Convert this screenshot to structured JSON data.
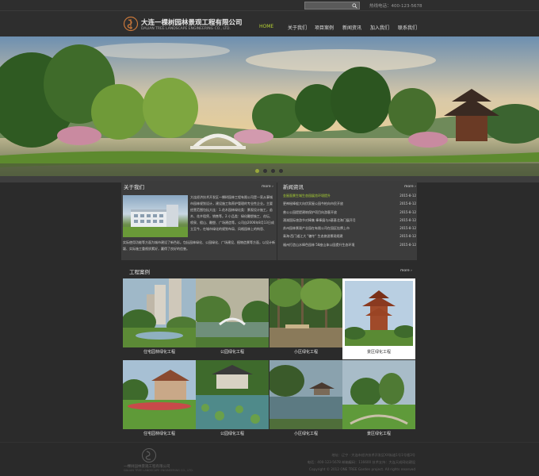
{
  "topbar": {
    "search_placeholder": "",
    "hotline": "热线电话：400-123-5678"
  },
  "brand": {
    "name_cn": "大连一棵树园林景观工程有限公司",
    "name_en": "DALIAN TREE LANDSCAPE ENGINEERING CO., LTD."
  },
  "nav": {
    "items": [
      {
        "label": "HOME",
        "active": true
      },
      {
        "label": "关于我们",
        "active": false
      },
      {
        "label": "项目案例",
        "active": false
      },
      {
        "label": "新闻资讯",
        "active": false
      },
      {
        "label": "加入我们",
        "active": false
      },
      {
        "label": "联系我们",
        "active": false
      }
    ]
  },
  "banner": {
    "slides": 4,
    "active_slide": 1
  },
  "about": {
    "title": "关于我们",
    "more": "more ›",
    "text_a": "大连经济技术开发区一棵树园林工程有限公司是一家从事城市园林规划设计，建设施工和养护管理的专业性企业。主要经营范围包括大连：1.花木园林绿化类：景观设计施工，苗木、花卉租赁，销售等。2.小品类：绿化雕塑施工、花坛、喷泉、假山、雕塑、广场建造等。公司自2006年8月13日成立至今，在城市绿化的规划布局、风格园林上的构思、",
    "text_b": "实际使用功能等方面为城市建设了新色彩。包括园林绿化、公园绿化、广场建设、植物造景等方面，以设计新颖、实际施工重视质素好，赢得了良好的信誉。"
  },
  "news": {
    "title": "新闻资讯",
    "more": "more ›",
    "items": [
      {
        "title": "金屋面景生城生态园展览环境提升",
        "date": "2015-8-12"
      },
      {
        "title": "更神秘棒般大向伏家屋公园今柏向市民开放",
        "date": "2015-8-12"
      },
      {
        "title": "普公公园提提建筑保护项目向游客开放",
        "date": "2015-8-12"
      },
      {
        "title": "涌湖国际旅游节对棒集 棒棒展与a基基北海门展开月",
        "date": "2015-8-12"
      },
      {
        "title": "苏州园林景观产业园在有限公司在园区挂牌上市",
        "date": "2015-8-12"
      },
      {
        "title": "青海·西门道江大 \"糖冬\" 生态旅游景观规建",
        "date": "2015-8-12"
      },
      {
        "title": "福州打造山水棒色园林 58座山体公园提升生态环境",
        "date": "2015-8-12"
      }
    ]
  },
  "cases": {
    "title": "工程案例",
    "more": "more ›",
    "items": [
      {
        "label": "住宅园林绿化工程"
      },
      {
        "label": "公园绿化工程"
      },
      {
        "label": "小区绿化工程"
      },
      {
        "label": "景区绿化工程",
        "selected": true
      },
      {
        "label": "住宅园林绿化工程"
      },
      {
        "label": "公园绿化工程"
      },
      {
        "label": "小区绿化工程"
      },
      {
        "label": "景区绿化工程"
      }
    ]
  },
  "footer": {
    "brand_cn": "一棵树园林景观工程有限公司",
    "brand_en": "DALIAN TREE LANDSCAPE ENGINEERING CO., LTD.",
    "address": "地址：辽宁 · 大连市经济技术开发区XX街道1号1号楼3号",
    "contact": "电话：400-123-5678   邮箱编码：116600   技术支持：大连天成网站建设",
    "copyright": "Copyright © 2012 ONE TREE Garden project. All rights reserved"
  },
  "colors": {
    "accent": "#b8d432",
    "background": "#2b2b2b",
    "panel": "#3c3c3c"
  }
}
